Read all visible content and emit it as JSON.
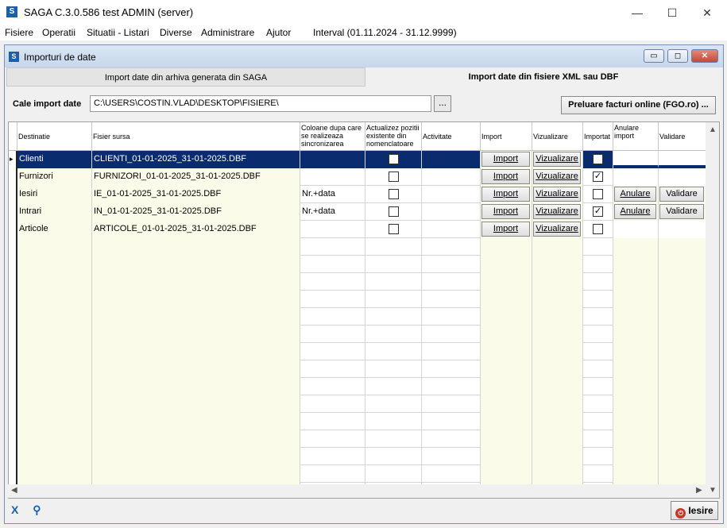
{
  "window": {
    "title": "SAGA C.3.0.586  test  ADMIN    (server)",
    "app_icon_glyph": "S",
    "minimize_glyph": "—",
    "maximize_glyph": "☐",
    "close_glyph": "✕"
  },
  "menu": {
    "items": [
      "Fisiere",
      "Operatii",
      "Situatii - Listari",
      "Diverse",
      "Administrare",
      "Ajutor"
    ],
    "interval": "Interval (01.11.2024 - 31.12.9999)"
  },
  "child": {
    "title": "Importuri de date",
    "minimize_glyph": "▭",
    "maximize_glyph": "◻",
    "close_glyph": "✕"
  },
  "tabs": {
    "tab1": "Import date din arhiva generata din SAGA",
    "tab2": "Import date din fisiere XML sau DBF"
  },
  "path": {
    "label": "Cale import date",
    "value": "C:\\USERS\\COSTIN.VLAD\\DESKTOP\\FISIERE\\",
    "browse_label": "...",
    "fgo_button": "Preluare facturi online  (FGO.ro) ..."
  },
  "grid": {
    "headers": {
      "destinatie": "Destinatie",
      "fisier": "Fisier sursa",
      "coloane": "Coloane dupa care se realizeaza sincronizarea",
      "actualizez": "Actualizez pozitii existente din nomenclatoare",
      "activitate": "Activitate",
      "import": "Import",
      "vizualizare": "Vizualizare",
      "importat": "Importat",
      "anulare": "Anulare import",
      "validare": "Validare"
    },
    "button_labels": {
      "import": "Import",
      "vizualizare": "Vizualizare",
      "anulare": "Anulare",
      "validare": "Validare"
    },
    "rows": [
      {
        "destinatie": "Clienti",
        "fisier": "CLIENTI_01-01-2025_31-01-2025.DBF",
        "coloane": "",
        "actualizez": false,
        "importat": false,
        "anulare": false,
        "validare": false
      },
      {
        "destinatie": "Furnizori",
        "fisier": "FURNIZORI_01-01-2025_31-01-2025.DBF",
        "coloane": "",
        "actualizez": false,
        "importat": true,
        "anulare": false,
        "validare": false
      },
      {
        "destinatie": "Iesiri",
        "fisier": "IE_01-01-2025_31-01-2025.DBF",
        "coloane": "Nr.+data",
        "actualizez": false,
        "importat": false,
        "anulare": true,
        "validare": true
      },
      {
        "destinatie": "Intrari",
        "fisier": "IN_01-01-2025_31-01-2025.DBF",
        "coloane": "Nr.+data",
        "actualizez": false,
        "importat": true,
        "anulare": true,
        "validare": true
      },
      {
        "destinatie": "Articole",
        "fisier": "ARTICOLE_01-01-2025_31-01-2025.DBF",
        "coloane": "",
        "actualizez": false,
        "importat": false,
        "anulare": false,
        "validare": false
      }
    ],
    "selected_row": 0,
    "selection_color": "#0a2c6e",
    "alt_bg": "#fbfbe9"
  },
  "footer": {
    "iesire": "Iesire",
    "iesire_icon_glyph": "⏻",
    "excel_icon": "X",
    "find_icon": "⚲"
  }
}
